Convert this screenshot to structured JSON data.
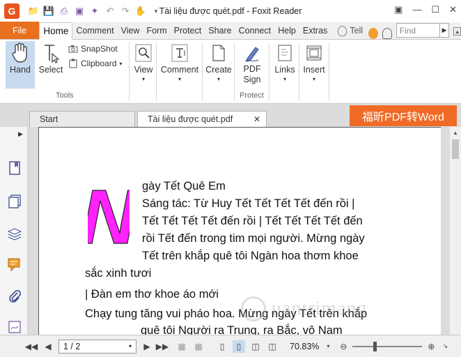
{
  "window": {
    "title": "Tài liệu được quét.pdf - Foxit Reader",
    "app_logo_letter": "G"
  },
  "ribbon_tabs": {
    "file": "File",
    "items": [
      "Home",
      "Comment",
      "View",
      "Form",
      "Protect",
      "Share",
      "Connect",
      "Help",
      "Extras"
    ],
    "tell": "Tell",
    "find_placeholder": "Find"
  },
  "ribbon": {
    "hand": "Hand",
    "select": "Select",
    "snapshot": "SnapShot",
    "clipboard": "Clipboard",
    "tools_group": "Tools",
    "view": "View",
    "comment": "Comment",
    "create": "Create",
    "pdf_sign_1": "PDF",
    "pdf_sign_2": "Sign",
    "protect_group": "Protect",
    "links": "Links",
    "insert": "Insert"
  },
  "doc_tabs": {
    "start": "Start",
    "current": "Tài liệu được quét.pdf",
    "promo": "福昕PDF转Word"
  },
  "document": {
    "dropcap": "N",
    "lines": [
      "gày Tết Quê Em",
      "Sáng tác: Từ Huy Tết Tết Tết Tết đến rồi |",
      "Tết Tết Tết Tết đến rồi | Tết Tết Tết Tết đến",
      "rồi Tết đến trong tim mọi người. Mừng ngày",
      "Tết trên khắp quê tôi Ngàn hoa thơm khoe",
      "sắc xinh tươi",
      "| Đàn em thơ khoe áo mới",
      "Chạy tung tăng vui pháo hoa. Mừng ngày Tết trên khắp",
      "quê tôi Người ra Trung, ra Bắc, vô Nam"
    ],
    "watermark": "uantrimang"
  },
  "status": {
    "page": "1 / 2",
    "zoom": "70.83%"
  },
  "colors": {
    "accent": "#e8701e",
    "dropcap": "#ff22ff",
    "promo": "#f06b25"
  }
}
